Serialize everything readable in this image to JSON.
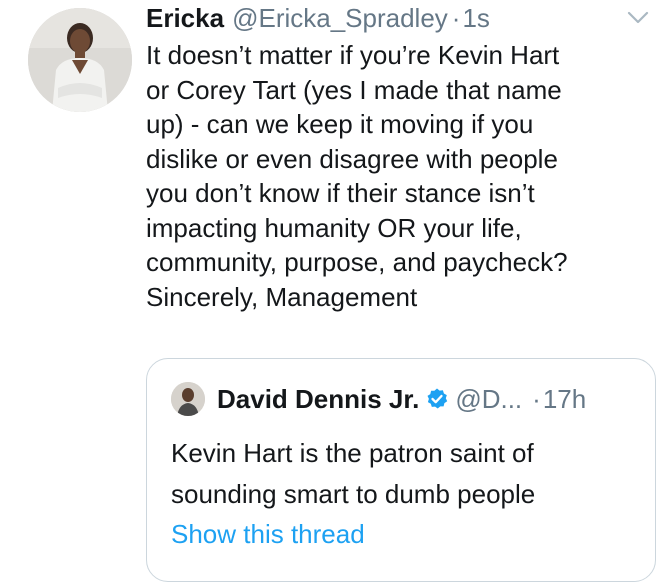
{
  "tweet": {
    "display_name": "Ericka",
    "handle": "@Ericka_Spradley",
    "separator": "·",
    "time": "1s",
    "avatar_icon": "profile-photo",
    "menu_icon": "chevron-down-icon",
    "text_lines": [
      "It doesn’t matter if you’re Kevin Hart",
      "or Corey Tart (yes I made that name",
      "up) - can we keep it moving if you",
      "dislike or even disagree with people",
      "you don’t know if their stance isn’t",
      "impacting humanity OR your life,",
      "community, purpose, and paycheck?",
      "Sincerely, Management"
    ]
  },
  "quoted_tweet": {
    "display_name": "David Dennis Jr.",
    "verified": true,
    "handle": "@D...",
    "separator": "·",
    "time": "17h",
    "text_lines": [
      "Kevin Hart is the patron saint of",
      "sounding smart to dumb people"
    ],
    "show_thread_label": "Show this thread"
  },
  "colors": {
    "text": "#14171a",
    "secondary": "#657786",
    "link": "#1da1f2",
    "border": "#ccd6dd"
  }
}
